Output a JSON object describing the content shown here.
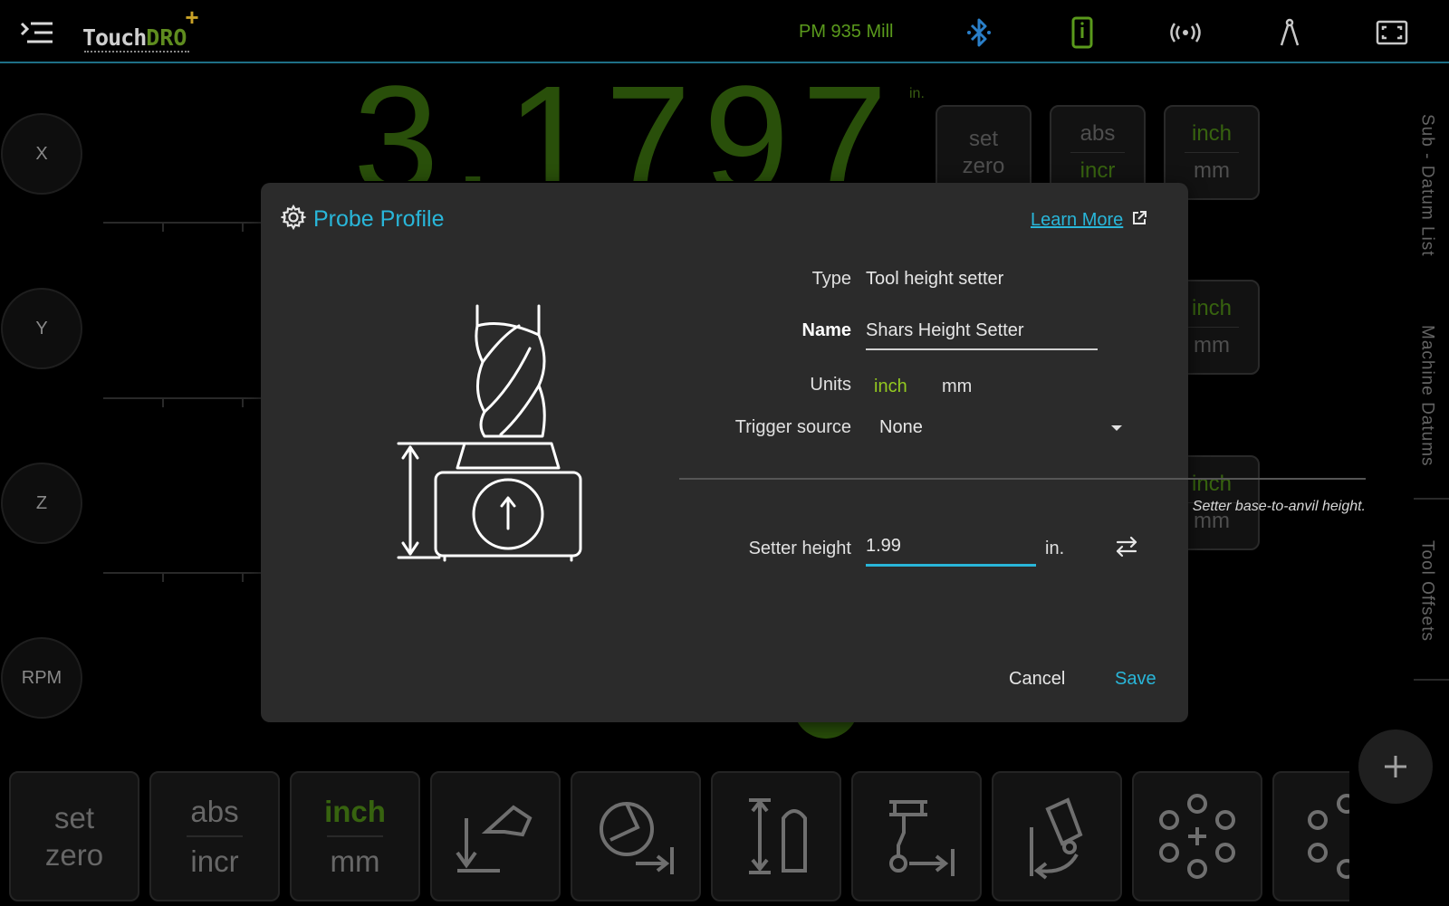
{
  "topbar": {
    "machine_name": "PM 935 Mill",
    "logo": {
      "part1": "Touch",
      "part2": "DRO",
      "plus": "+"
    }
  },
  "axes": [
    {
      "label": "X"
    },
    {
      "label": "Y"
    },
    {
      "label": "Z"
    },
    {
      "label": "RPM"
    }
  ],
  "readout": {
    "value": "3.1797",
    "unit": "in."
  },
  "axis_buttons": {
    "set": "set",
    "zero": "zero",
    "abs": "abs",
    "incr": "incr",
    "inch": "inch",
    "mm": "mm"
  },
  "side_tabs": [
    "Sub - Datum List",
    "Machine Datums",
    "Tool Offsets"
  ],
  "toolbar": {
    "set": "set",
    "zero": "zero",
    "abs": "abs",
    "incr": "incr",
    "inch": "inch",
    "mm": "mm"
  },
  "dialog": {
    "title": "Probe Profile",
    "learn_more": "Learn More",
    "type_label": "Type",
    "type_value": "Tool height setter",
    "name_label": "Name",
    "name_value": "Shars Height Setter",
    "units_label": "Units",
    "unit_inch": "inch",
    "unit_mm": "mm",
    "selected_unit": "inch",
    "trigger_label": "Trigger source",
    "trigger_value": "None",
    "hint": "Setter base-to-anvil height.",
    "height_label": "Setter height",
    "height_value": "1.99",
    "height_unit": "in.",
    "cancel": "Cancel",
    "save": "Save"
  },
  "colors": {
    "accent_blue": "#29b6d9",
    "active_green": "#93c920",
    "dro_green": "#3a6e0e",
    "dialog_bg": "#2b2b2b"
  },
  "icons": [
    "menu-icon",
    "bluetooth-icon",
    "tablet-icon",
    "wireless-icon",
    "compass-icon",
    "fullscreen-icon",
    "gear-icon",
    "external-link-icon",
    "dropdown-arrow-icon",
    "swap-icon",
    "plus-icon"
  ]
}
